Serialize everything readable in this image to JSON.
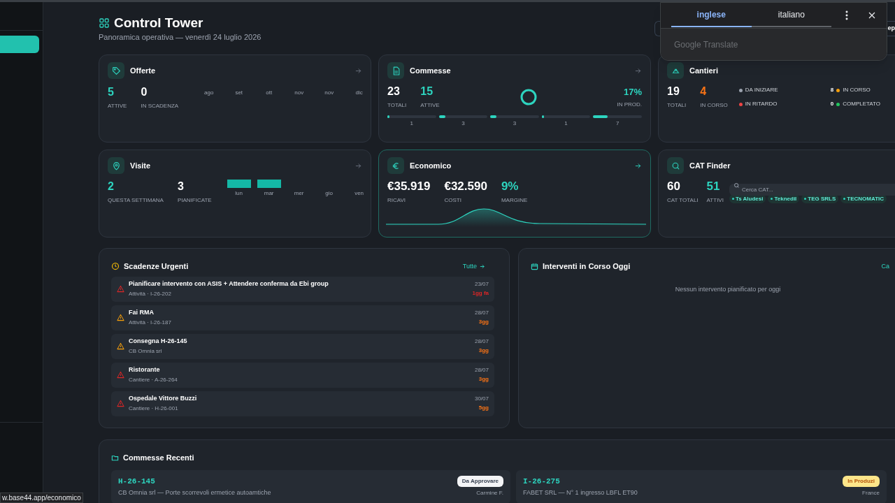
{
  "header": {
    "title": "Control Tower",
    "subtitle": "Panoramica operativa — venerdì 24 luglio 2026",
    "button_text": "ep"
  },
  "translate_popup": {
    "tabs": [
      {
        "label": "inglese",
        "selected": true
      },
      {
        "label": "italiano",
        "selected": false
      }
    ],
    "brand": "Google Translate"
  },
  "offerte": {
    "title": "Offerte",
    "stats": [
      {
        "value": "5",
        "label": "ATTIVE",
        "kind": "accent"
      },
      {
        "value": "0",
        "label": "IN SCADENZA",
        "kind": "plain"
      }
    ],
    "months": [
      "ago",
      "set",
      "ott",
      "nov",
      "nov",
      "dic"
    ]
  },
  "commesse": {
    "title": "Commesse",
    "stats": [
      {
        "value": "23",
        "label": "TOTALI",
        "kind": "plain"
      },
      {
        "value": "15",
        "label": "ATTIVE",
        "kind": "accent"
      }
    ],
    "percent": "17%",
    "percent_label": "IN PROD.",
    "bars": [
      {
        "count": "1",
        "level": 0.04
      },
      {
        "count": "3",
        "level": 0.13
      },
      {
        "count": "3",
        "level": 0.13
      },
      {
        "count": "1",
        "level": 0.04
      },
      {
        "count": "7",
        "level": 0.3
      }
    ]
  },
  "cantieri": {
    "title": "Cantieri",
    "stats": [
      {
        "value": "19",
        "label": "TOTALI",
        "kind": "plain"
      },
      {
        "value": "4",
        "label": "IN CORSO",
        "kind": "warn"
      }
    ],
    "legend": [
      {
        "label": "DA INIZIARE",
        "color": "#9ca3af"
      },
      {
        "label": "IN RITARDO",
        "color": "#ef4444"
      },
      {
        "count": "8",
        "label": "IN CORSO",
        "color": "#f59e0b"
      },
      {
        "count": "0",
        "label": "COMPLETATO",
        "color": "#22c55e"
      }
    ]
  },
  "visite": {
    "title": "Visite",
    "stats": [
      {
        "value": "2",
        "label": "QUESTA SETTIMANA",
        "kind": "accent"
      },
      {
        "value": "3",
        "label": "PIANIFICATE",
        "kind": "plain"
      }
    ],
    "days": [
      {
        "label": "lun",
        "has_bar": true
      },
      {
        "label": "mar",
        "has_bar": true
      },
      {
        "label": "mer",
        "has_bar": false
      },
      {
        "label": "gio",
        "has_bar": false
      },
      {
        "label": "ven",
        "has_bar": false
      }
    ]
  },
  "economico": {
    "title": "Economico",
    "stats": [
      {
        "value": "€35.919",
        "label": "RICAVI",
        "kind": "plain"
      },
      {
        "value": "€32.590",
        "label": "COSTI",
        "kind": "plain"
      },
      {
        "value": "9%",
        "label": "MARGINE",
        "kind": "accent"
      }
    ]
  },
  "cat_finder": {
    "title": "CAT Finder",
    "stats": [
      {
        "value": "60",
        "label": "CAT TOTALI",
        "kind": "plain"
      },
      {
        "value": "51",
        "label": "ATTIVI",
        "kind": "accent"
      }
    ],
    "search": {
      "placeholder": "Cerca CAT..."
    },
    "tags": [
      "Ts Aludesi",
      "Teknedil",
      "TEG SRLS",
      "TECNOMATIC"
    ]
  },
  "scadenze": {
    "title": "Scadenze Urgenti",
    "link": "Tutte",
    "items": [
      {
        "title": "Pianificare intervento con ASIS + Attendere conferma da Ebi group",
        "subtitle": "Attività · I-26-202",
        "date": "23/07",
        "due": "1gg fa",
        "color": "#dc2626",
        "overdue": true
      },
      {
        "title": "Fai RMA",
        "subtitle": "Attività · I-26-187",
        "date": "28/07",
        "due": "3gg",
        "color": "#f59e0b",
        "overdue": false
      },
      {
        "title": "Consegna H-26-145",
        "subtitle": "CB Omnia srl",
        "date": "28/07",
        "due": "3gg",
        "color": "#f59e0b",
        "overdue": false
      },
      {
        "title": "Ristorante",
        "subtitle": "Cantiere · A-26-264",
        "date": "28/07",
        "due": "3gg",
        "color": "#dc2626",
        "overdue": false
      },
      {
        "title": "Ospedale Vittore Buzzi",
        "subtitle": "Cantiere · H-26-001",
        "date": "30/07",
        "due": "5gg",
        "color": "#dc2626",
        "overdue": false
      }
    ]
  },
  "interventi": {
    "title": "Interventi in Corso Oggi",
    "link": "Ca",
    "empty": "Nessun intervento pianificato per oggi"
  },
  "commesse_recenti": {
    "title": "Commesse Recenti",
    "items": [
      {
        "code": "H-26-145",
        "description": "CB Omnia srl — Porte scorrevoli ermetice autoamtiche",
        "status": "Da Approvare",
        "kind": "pending",
        "person": "Carmine F."
      },
      {
        "code": "I-26-275",
        "description": "FABET SRL — N° 1 ingresso LBFL ET90",
        "status": "In Produzi",
        "kind": "production",
        "person": "France"
      }
    ]
  },
  "status_bar": {
    "url": "w.base44.app/economico"
  }
}
